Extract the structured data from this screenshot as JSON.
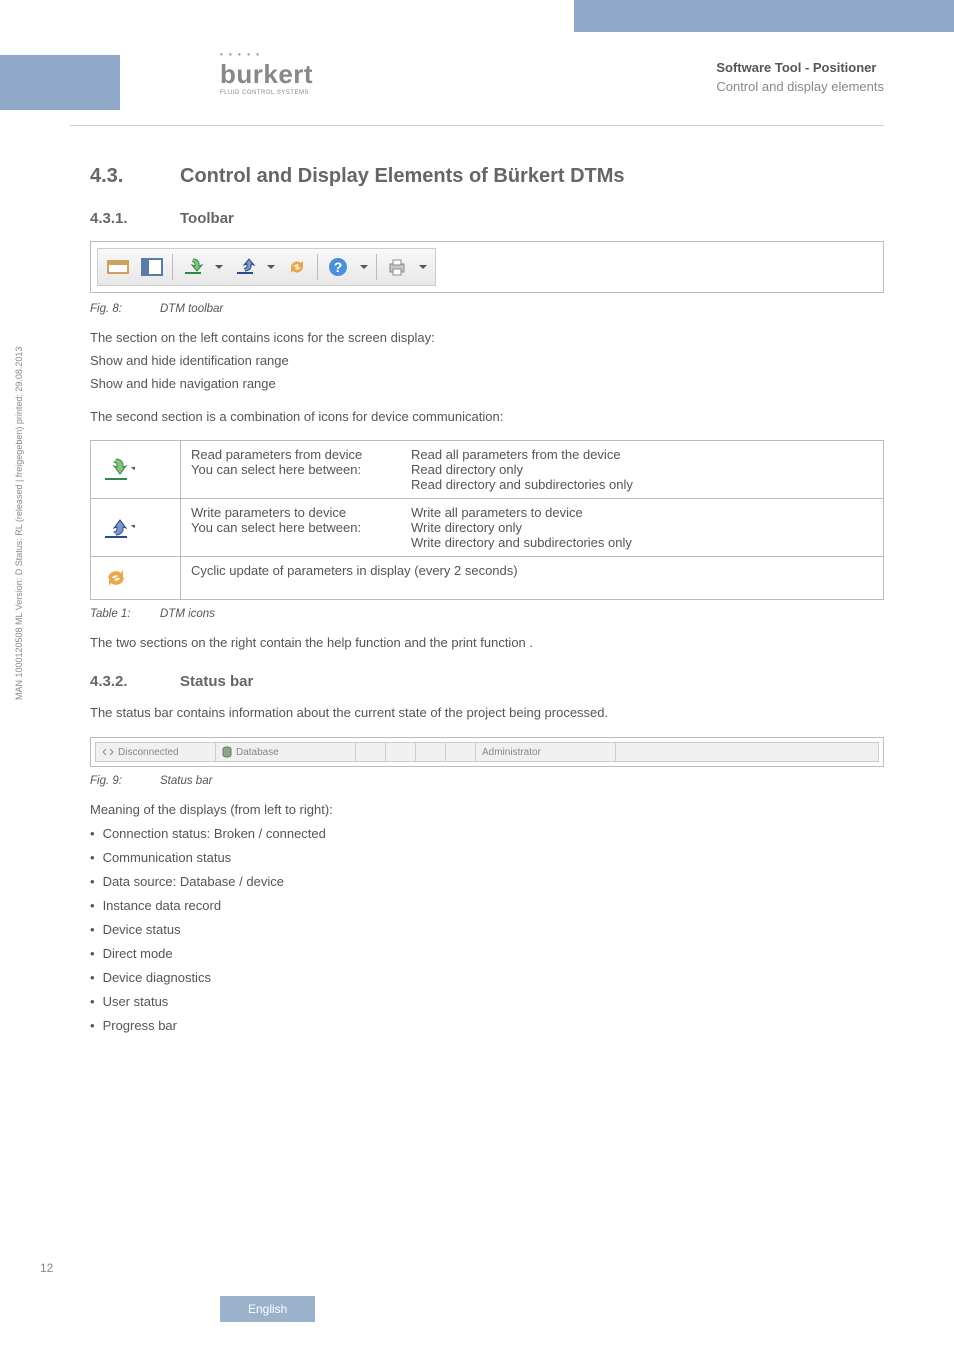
{
  "header": {
    "brand": "burkert",
    "brand_sub": "FLUID CONTROL SYSTEMS",
    "title_bold": "Software Tool - Positioner",
    "title_sub": "Control and display elements"
  },
  "section": {
    "num": "4.3.",
    "title": "Control and Display Elements of Bürkert DTMs"
  },
  "sub1": {
    "num": "4.3.1.",
    "title": "Toolbar"
  },
  "fig8": {
    "label": "Fig. 8:",
    "text": "DTM toolbar"
  },
  "para1a": "The section on the left contains icons for the screen display:",
  "para1b": "Show and hide identification range",
  "para1c": "Show and hide navigation range",
  "para2": "The second section is a combination of icons for device communication:",
  "icons_table": [
    {
      "name": "read-params-icon",
      "left_a": "Read parameters from device",
      "left_b": "You can select here between:",
      "right": [
        "Read all parameters from the device",
        "Read directory only",
        "Read directory and subdirectories only"
      ]
    },
    {
      "name": "write-params-icon",
      "left_a": "Write parameters to device",
      "left_b": "You can select here between:",
      "right": [
        "Write all parameters to device",
        "Write directory only",
        "Write directory and subdirectories only"
      ]
    },
    {
      "name": "cyclic-update-icon",
      "full": "Cyclic update of parameters in display (every 2 seconds)"
    }
  ],
  "table1": {
    "label": "Table 1:",
    "text": "DTM icons"
  },
  "para3": "The two sections on the right contain the help function and the print function .",
  "sub2": {
    "num": "4.3.2.",
    "title": "Status bar"
  },
  "para4": "The status bar contains information about the current state of the project being processed.",
  "statusbar": {
    "disconnected": "Disconnected",
    "database": "Database",
    "admin": "Administrator"
  },
  "fig9": {
    "label": "Fig. 9:",
    "text": "Status bar"
  },
  "para5": "Meaning of the displays (from left to right):",
  "bullets": [
    "Connection status: Broken / connected",
    "Communication status",
    "Data source: Database / device",
    "Instance data record",
    "Device status",
    "Direct mode",
    "Device diagnostics",
    "User status",
    "Progress bar"
  ],
  "side": "MAN  1000120508  ML  Version: D  Status: RL (released | freigegeben)  printed: 29.08.2013",
  "page": "12",
  "lang": "English"
}
